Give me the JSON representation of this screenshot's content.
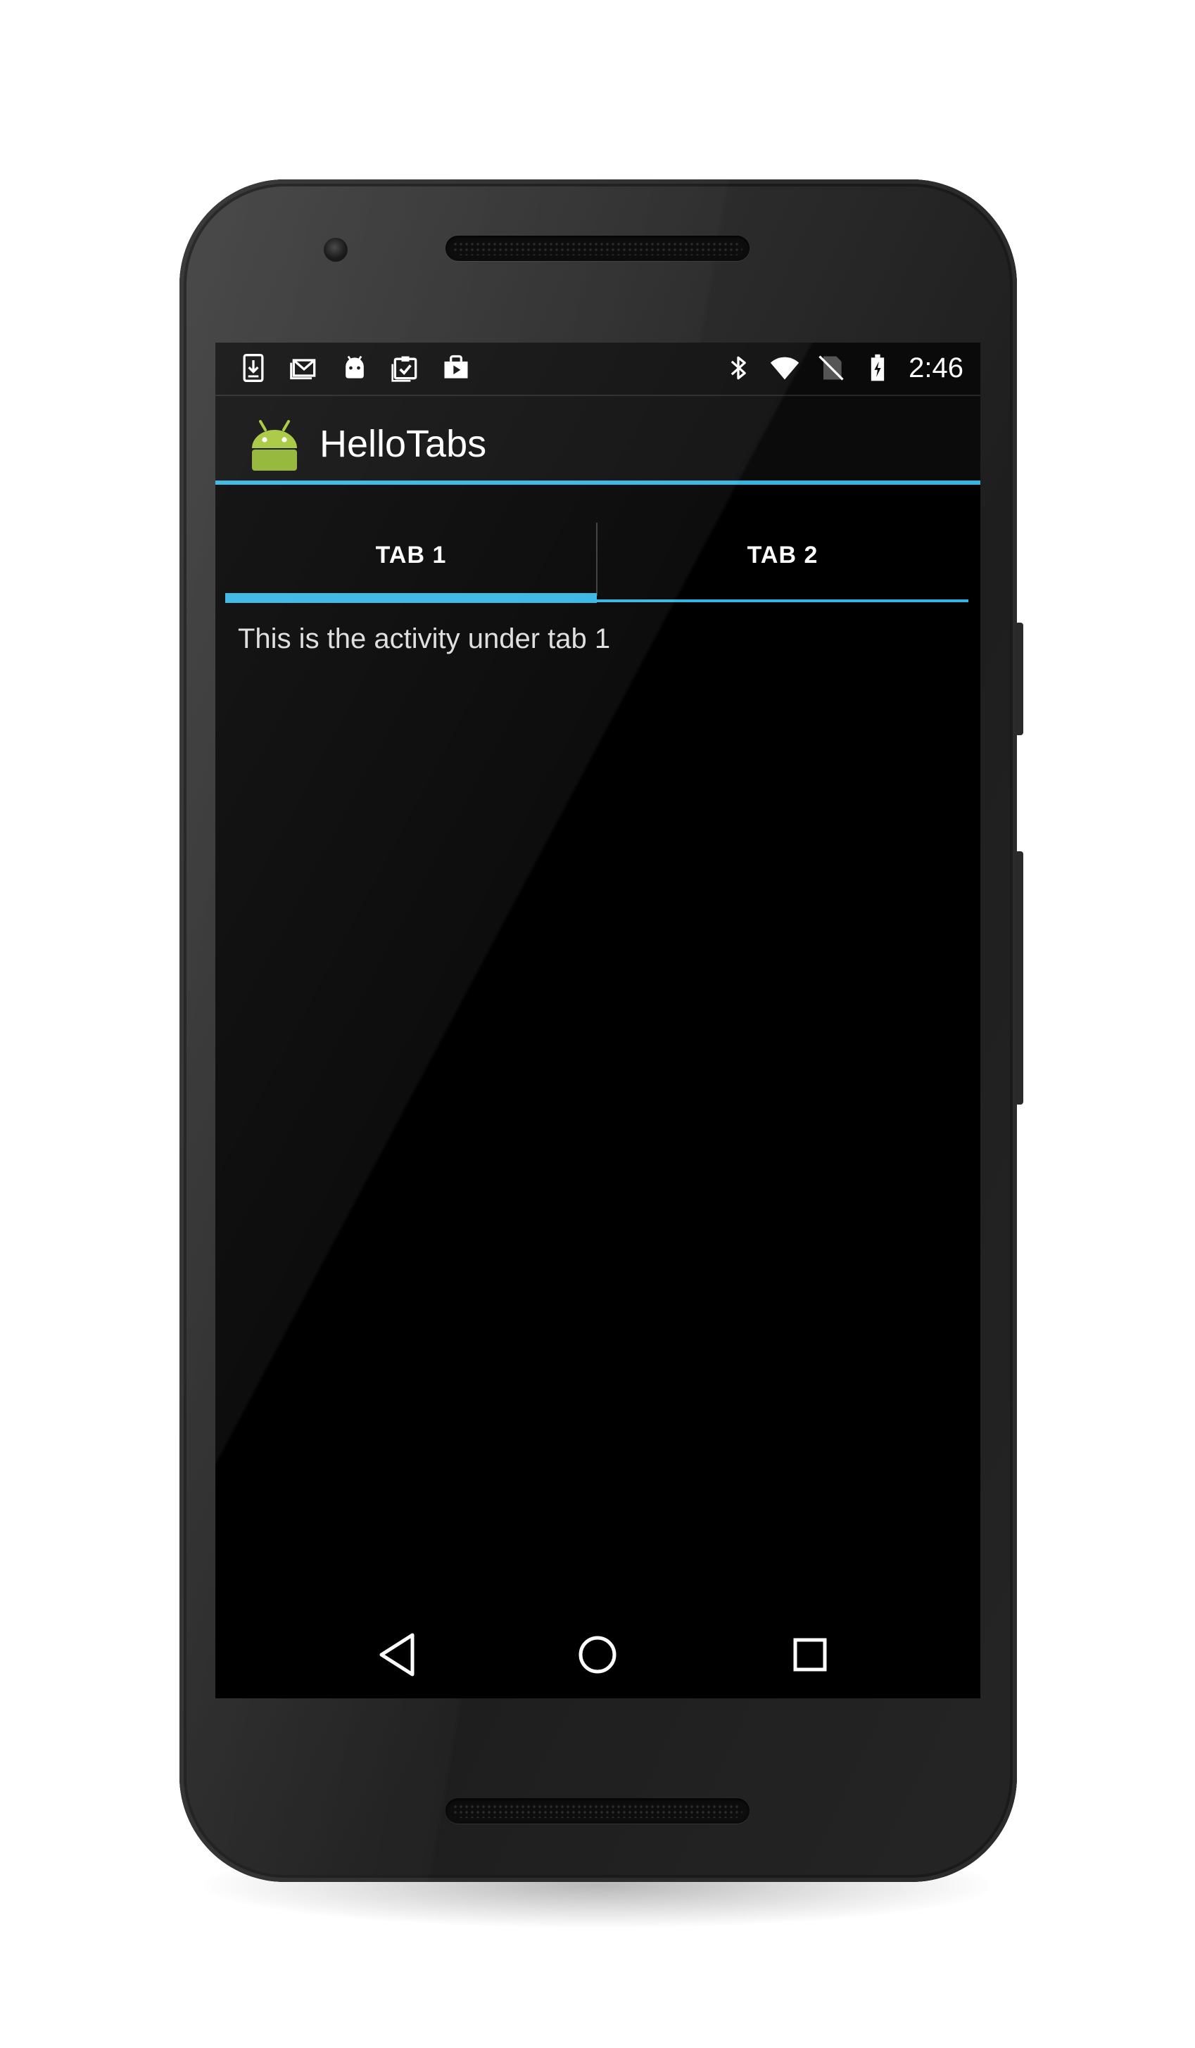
{
  "status_bar": {
    "time": "2:46",
    "notification_icons": [
      "download-icon",
      "gmail-icon",
      "android-debug-icon",
      "clipboard-check-icon",
      "play-store-icon"
    ],
    "system_icons": [
      "bluetooth-icon",
      "wifi-icon",
      "no-signal-icon",
      "battery-charging-icon"
    ]
  },
  "action_bar": {
    "title": "HelloTabs",
    "icon": "android-icon"
  },
  "tabs": [
    {
      "label": "TAB 1",
      "selected": true
    },
    {
      "label": "TAB 2",
      "selected": false
    }
  ],
  "content": {
    "text": "This is the activity under tab 1"
  },
  "nav_bar": {
    "buttons": [
      "back-icon",
      "home-icon",
      "recents-icon"
    ]
  },
  "colors": {
    "accent": "#33b5e5",
    "screen_background": "#000000",
    "android_green": "#a4c639"
  }
}
